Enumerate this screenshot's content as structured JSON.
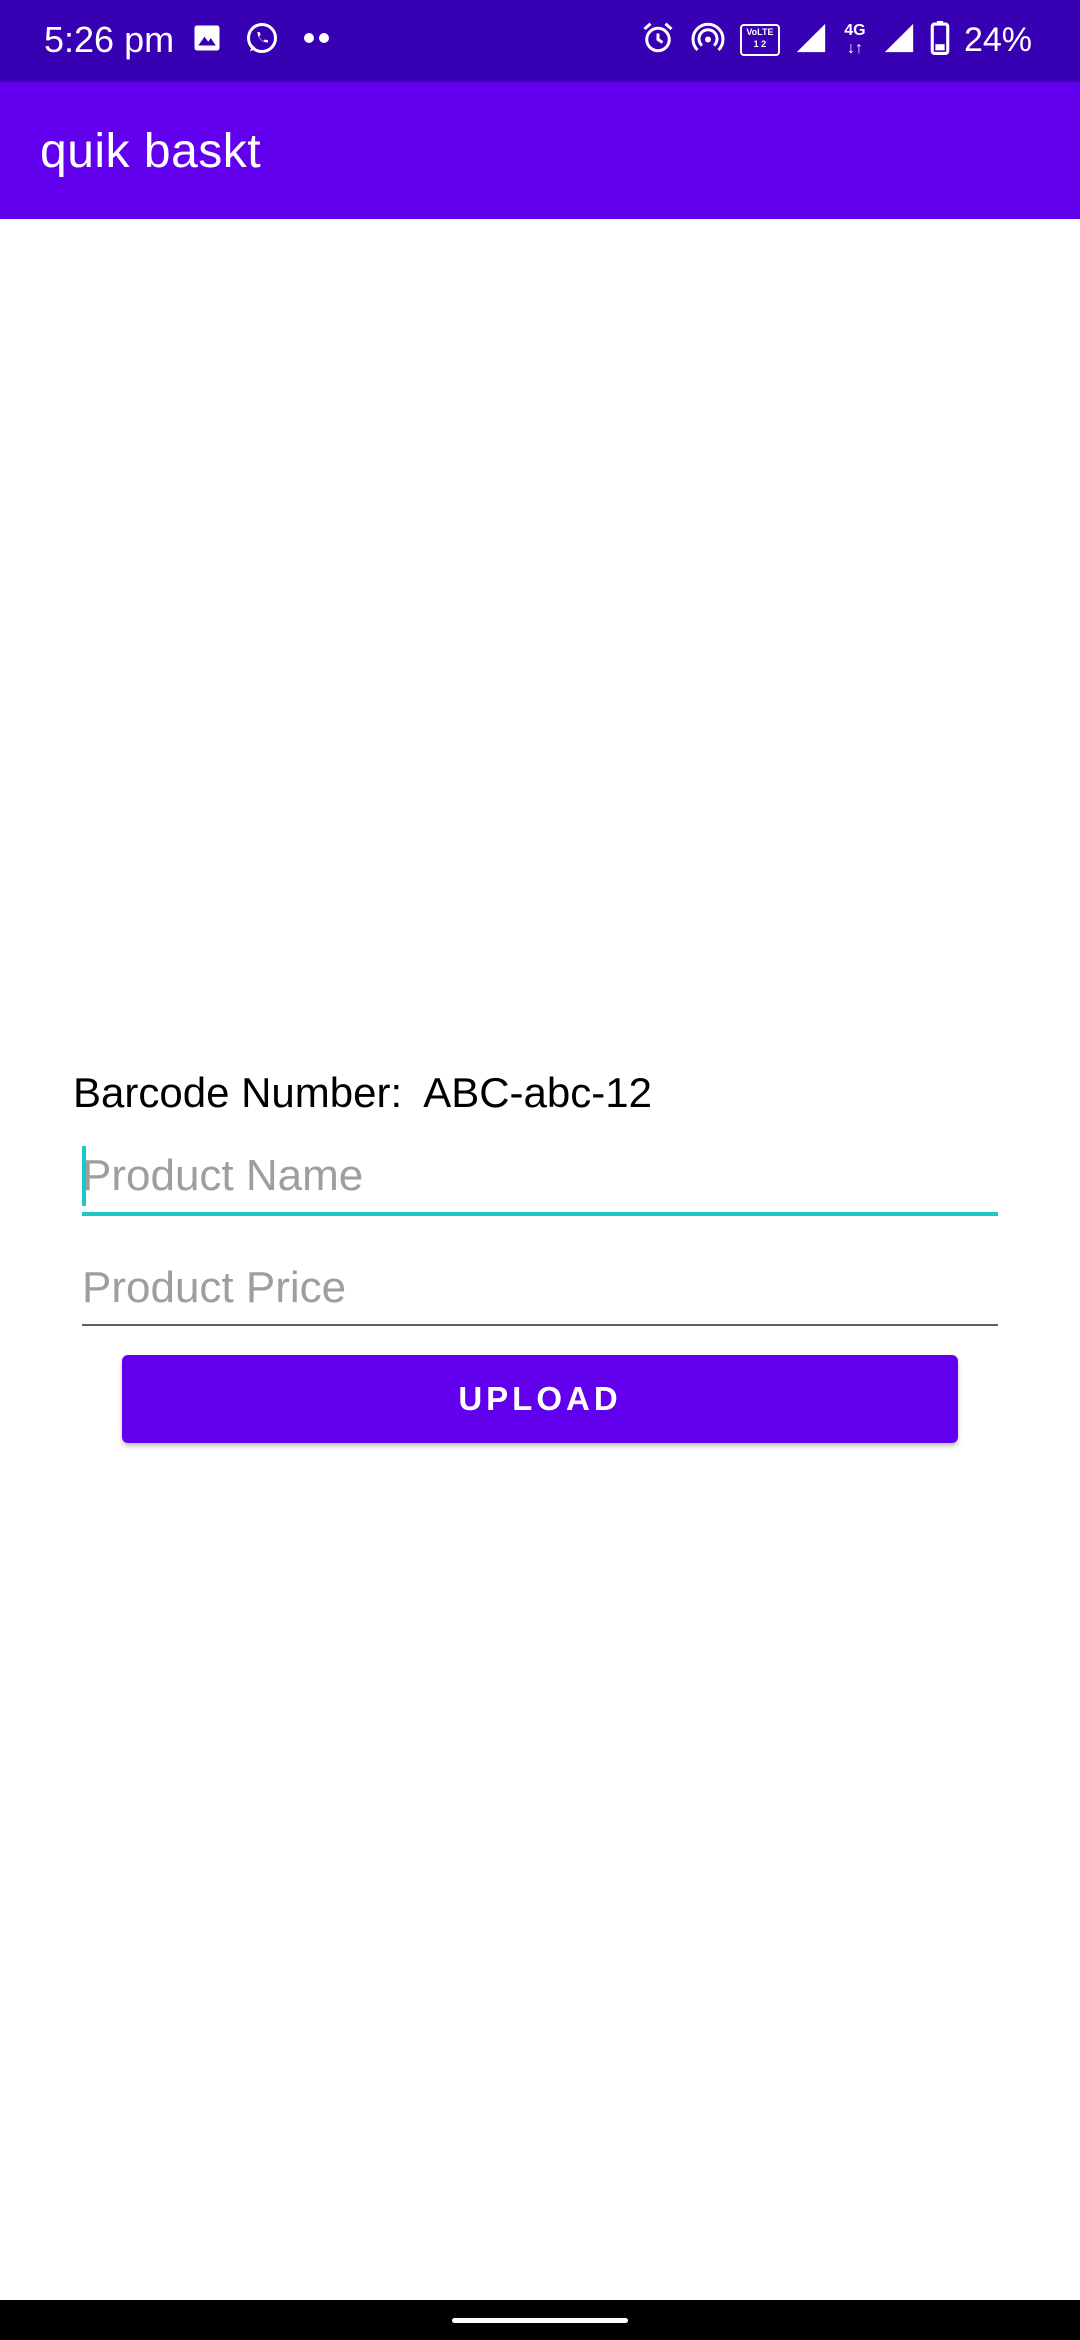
{
  "status_bar": {
    "time": "5:26 pm",
    "battery": "24%",
    "volte_top": "VoLTE",
    "volte_bottom": "1 2",
    "network": "4G",
    "icons": [
      "gallery-icon",
      "whatsapp-icon",
      "more-notifications-icon",
      "alarm-icon",
      "hotspot-icon",
      "volte-icon",
      "signal-icon",
      "data-arrows-icon",
      "signal-icon",
      "battery-icon"
    ]
  },
  "app_bar": {
    "title": "quik baskt"
  },
  "form": {
    "barcode_label": "Barcode Number:",
    "barcode_value": "ABC-abc-12",
    "product_name_placeholder": "Product Name",
    "product_price_placeholder": "Product Price",
    "upload_label": "UPLOAD"
  },
  "colors": {
    "status_bar": "#3700b3",
    "primary": "#6200ee",
    "accent": "#1fc6c6"
  }
}
